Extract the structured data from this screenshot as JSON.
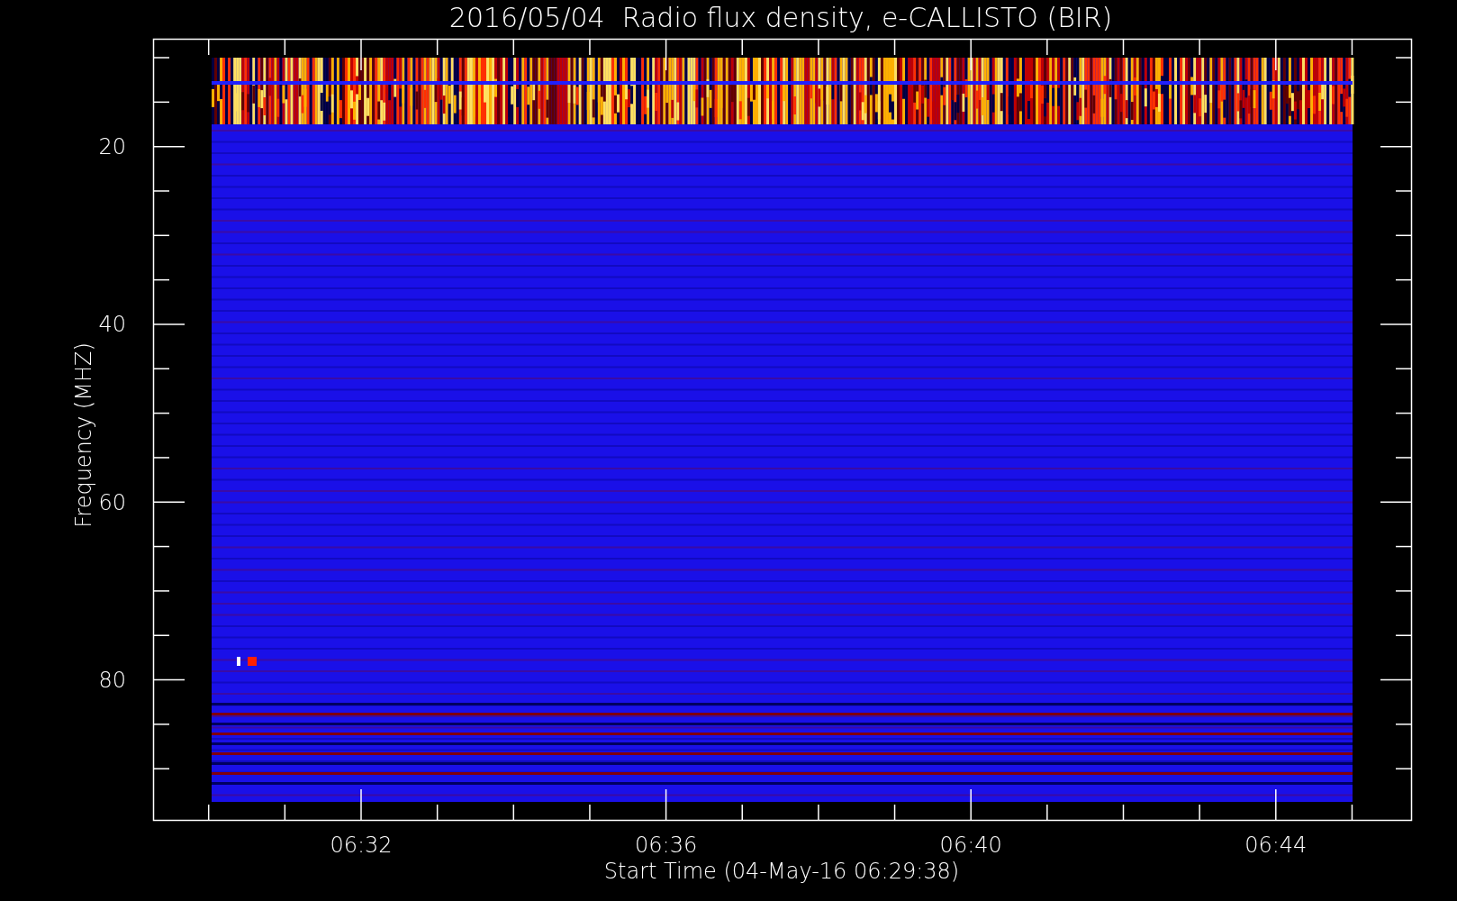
{
  "title": "2016/05/04  Radio flux density, e-CALLISTO (BIR)",
  "y_axis": {
    "label": "Frequency (MHZ)",
    "ticks": [
      "20",
      "40",
      "60",
      "80"
    ]
  },
  "x_axis": {
    "label": "Start Time (04-May-16 06:29:38)",
    "ticks": [
      "06:32",
      "06:36",
      "06:40",
      "06:44"
    ]
  }
}
